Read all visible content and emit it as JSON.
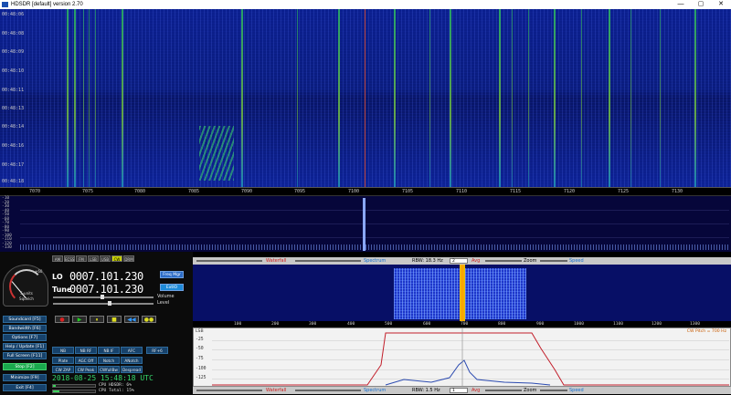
{
  "window": {
    "title": "HDSDR [default]  version 2.70",
    "min": "—",
    "max": "▢",
    "close": "✕"
  },
  "waterfall": {
    "times": [
      "00:48:06",
      "00:48:08",
      "00:48:09",
      "00:48:10",
      "00:48:11",
      "00:48:13",
      "00:48:14",
      "00:48:16",
      "00:48:17",
      "00:48:18"
    ]
  },
  "freq_scale": [
    "7070",
    "7075",
    "7080",
    "7085",
    "7090",
    "7095",
    "7100",
    "7105",
    "7110",
    "7115",
    "7120",
    "7125",
    "7130"
  ],
  "spectrum": {
    "db_labels": [
      "-10",
      "-20",
      "-30",
      "-40",
      "-50",
      "-60",
      "-70",
      "-80",
      "-90",
      "-100",
      "-110",
      "-120",
      "-130"
    ]
  },
  "modes": [
    "AM",
    "ECSS",
    "FM",
    "LSB",
    "USB",
    "CW",
    "DRM"
  ],
  "active_mode": "CW",
  "smeter": {
    "scale": "+60",
    "label": "S-units",
    "sub": "Squelch"
  },
  "lo": {
    "label": "LO",
    "value": "0007.101.230"
  },
  "tune": {
    "label": "Tune",
    "value": "0007.101.230"
  },
  "side": {
    "freq_mgr": "Freq Mgr",
    "extio": "ExtIO",
    "volume": "Volume",
    "level": "Level"
  },
  "transport": [
    "●",
    "▶",
    "⏸",
    "■",
    "◀◀",
    "●●"
  ],
  "fkeys": [
    {
      "label": "Soundcard  [F5]"
    },
    {
      "label": "Bandwidth  [F6]"
    },
    {
      "label": "Options  [F7]"
    },
    {
      "label": "Help / Update  [F1]"
    },
    {
      "label": "Full Screen  [F11]"
    },
    {
      "label": "Stop  [F2]"
    },
    {
      "label": "Minimize  [F9]"
    },
    {
      "label": "Exit  [F4]"
    }
  ],
  "dsp": [
    "NB",
    "NB RF",
    "NB IF",
    "AFC",
    "RF+6",
    "Plate",
    "AGC Off",
    "Notch",
    "ANotch",
    "CW ZAP",
    "CW Peak",
    "CWfullBw",
    "Despread"
  ],
  "datetime": "2018-08-25  15:48:18 UTC",
  "cpu": {
    "hdsdr": "CPU HDSDR: 6%",
    "total": "CPU Total: 15%",
    "hdsdr_level": 0.06,
    "total_level": 0.15
  },
  "toolbar_top": {
    "waterfall": "Waterfall",
    "spectrum": "Spectrum",
    "rbw": "RBW: 18.3 Hz",
    "avg_value": "2",
    "avg": "Avg",
    "zoom": "Zoom",
    "speed": "Speed"
  },
  "toolbar_bottom": {
    "waterfall": "Waterfall",
    "spectrum": "Spectrum",
    "rbw": "RBW: 1.5 Hz",
    "avg_value": "1",
    "avg": "Avg",
    "zoom": "Zoom",
    "speed": "Speed"
  },
  "zoom_scale": [
    "100",
    "200",
    "300",
    "400",
    "500",
    "600",
    "700",
    "800",
    "900",
    "1000",
    "1100",
    "1200",
    "1300"
  ],
  "zoom_spec": {
    "db": [
      "-25",
      "-50",
      "-75",
      "-100",
      "-125"
    ],
    "cw_pitch": "CW Pitch = 700 Hz",
    "marker": "LSB"
  },
  "colors": {
    "accent_green": "#1aa84d",
    "fkey_blue": "#17426b",
    "carrier": "#e8c000"
  }
}
